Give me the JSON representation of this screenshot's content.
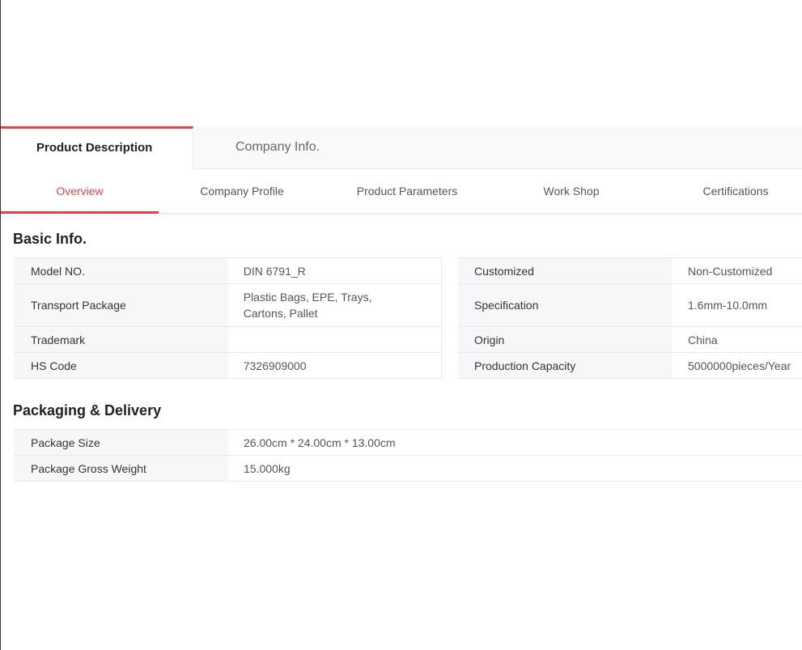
{
  "tabs": {
    "primary": [
      {
        "label": "Product Description",
        "active": true
      },
      {
        "label": "Company Info.",
        "active": false
      }
    ],
    "secondary": [
      {
        "label": "Overview",
        "active": true
      },
      {
        "label": "Company Profile",
        "active": false
      },
      {
        "label": "Product Parameters",
        "active": false
      },
      {
        "label": "Work Shop",
        "active": false
      },
      {
        "label": "Certifications",
        "active": false
      }
    ]
  },
  "basic_info": {
    "title": "Basic Info.",
    "left": [
      {
        "key": "Model NO.",
        "value": "DIN 6791_R"
      },
      {
        "key": "Transport Package",
        "value": "Plastic Bags, EPE, Trays, Cartons, Pallet"
      },
      {
        "key": "Trademark",
        "value": ""
      },
      {
        "key": "HS Code",
        "value": "7326909000"
      }
    ],
    "right": [
      {
        "key": "Customized",
        "value": "Non-Customized"
      },
      {
        "key": "Specification",
        "value": "1.6mm-10.0mm"
      },
      {
        "key": "Origin",
        "value": "China"
      },
      {
        "key": "Production Capacity",
        "value": "5000000pieces/Year"
      }
    ]
  },
  "packaging": {
    "title": "Packaging & Delivery",
    "rows": [
      {
        "key": "Package Size",
        "value": "26.00cm * 24.00cm * 13.00cm"
      },
      {
        "key": "Package Gross Weight",
        "value": "15.000kg"
      }
    ]
  },
  "colors": {
    "accent": "#e0444b",
    "label_bg": "#f6f7f9",
    "tab_bar_bg": "#f7f9fb"
  }
}
